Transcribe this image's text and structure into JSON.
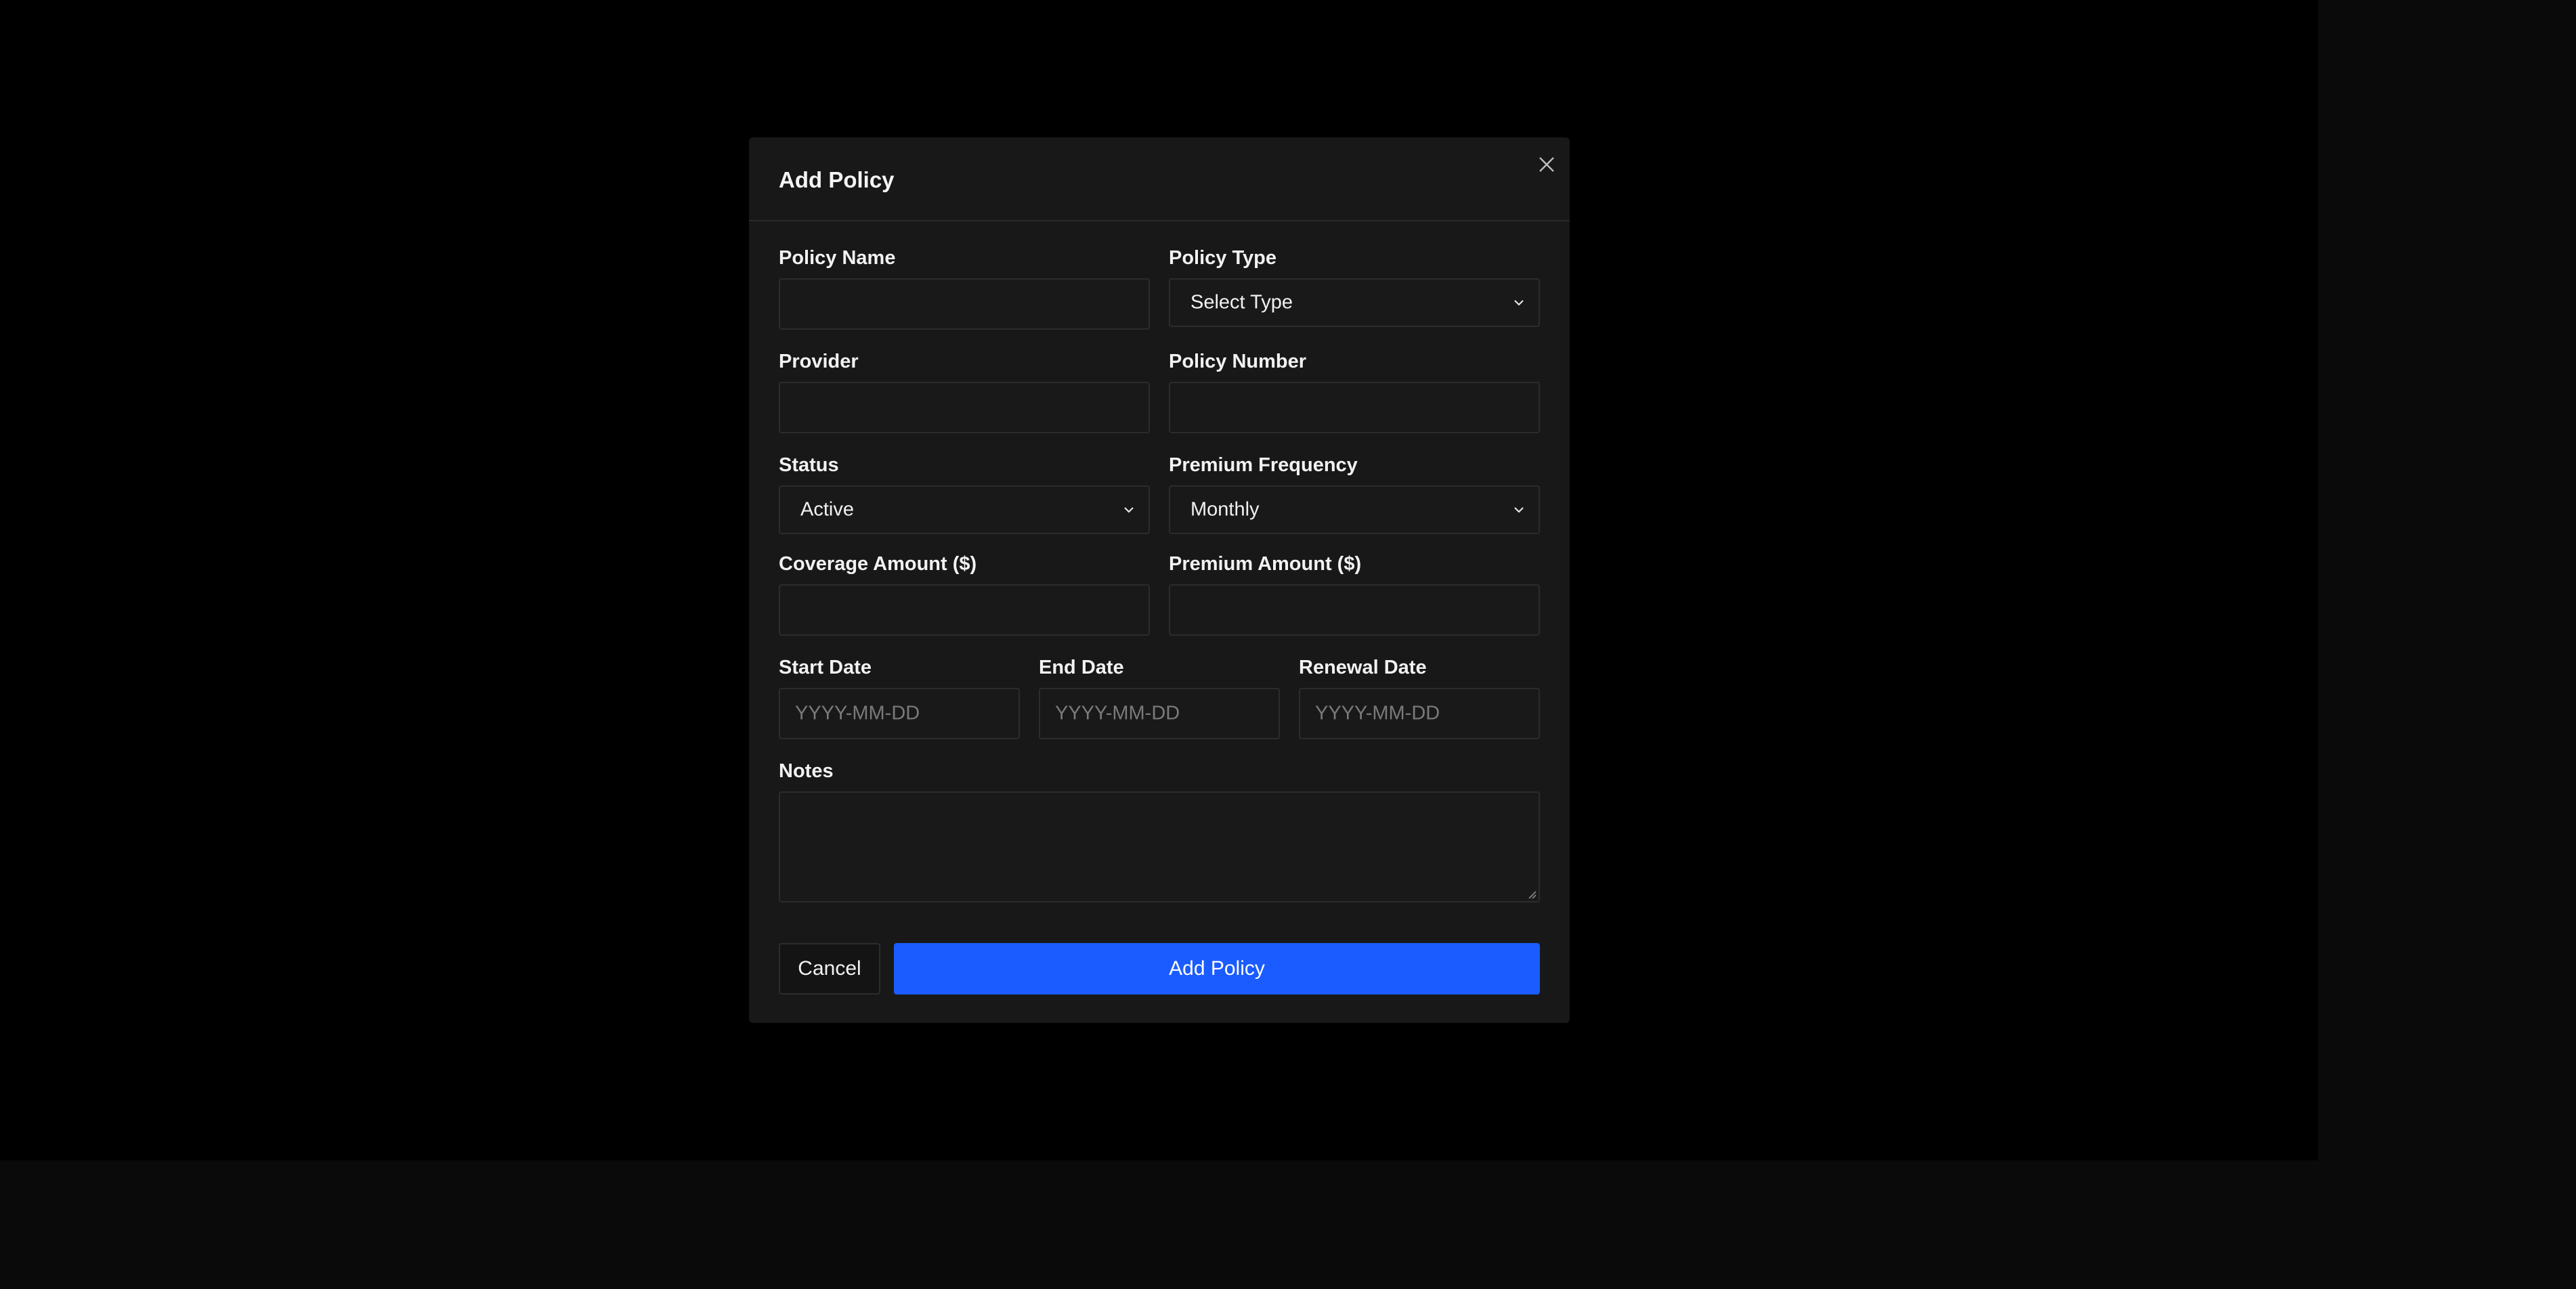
{
  "modal": {
    "title": "Add Policy",
    "close_icon": "close-icon"
  },
  "form": {
    "policy_name": {
      "label": "Policy Name",
      "value": ""
    },
    "policy_type": {
      "label": "Policy Type",
      "selected": "Select Type"
    },
    "provider": {
      "label": "Provider",
      "value": ""
    },
    "policy_number": {
      "label": "Policy Number",
      "value": ""
    },
    "status": {
      "label": "Status",
      "selected": "Active"
    },
    "premium_frequency": {
      "label": "Premium Frequency",
      "selected": "Monthly"
    },
    "coverage_amount": {
      "label": "Coverage Amount ($)",
      "value": ""
    },
    "premium_amount": {
      "label": "Premium Amount ($)",
      "value": ""
    },
    "start_date": {
      "label": "Start Date",
      "placeholder": "YYYY-MM-DD"
    },
    "end_date": {
      "label": "End Date",
      "placeholder": "YYYY-MM-DD"
    },
    "renewal_date": {
      "label": "Renewal Date",
      "placeholder": "YYYY-MM-DD"
    },
    "notes": {
      "label": "Notes",
      "value": ""
    }
  },
  "actions": {
    "cancel_label": "Cancel",
    "submit_label": "Add Policy"
  },
  "colors": {
    "backdrop": "#000000",
    "page": "#0a0a0a",
    "modal": "#181818",
    "primary": "#1a5cff"
  }
}
